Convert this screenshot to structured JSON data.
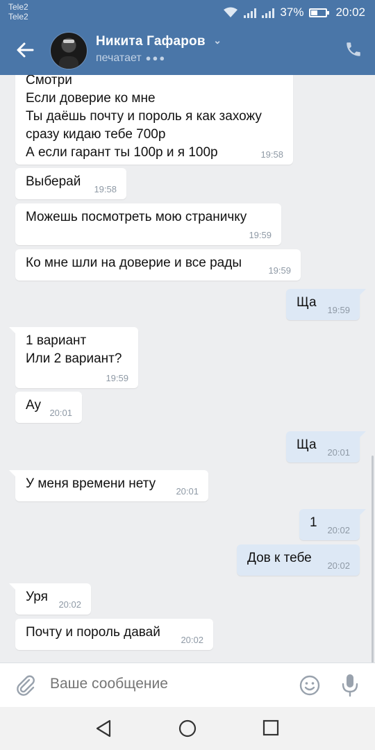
{
  "status_bar": {
    "carrier1": "Tele2",
    "carrier2": "Tele2",
    "battery": "37%",
    "time": "20:02",
    "icons": [
      "wifi-icon",
      "signal-icon",
      "signal-icon",
      "battery-icon"
    ]
  },
  "header": {
    "name": "Никита Гафаров",
    "status": "печатает",
    "icons": [
      "back-arrow-icon",
      "chevron-down-icon",
      "phone-icon"
    ]
  },
  "messages": [
    {
      "dir": "in",
      "text": "Смотри\nЕсли доверие ко мне\nТы даёшь почту и пороль я как захожу\nсразу кидаю тебе 700р\nА если гарант ты 100р и я 100р",
      "time": "19:58"
    },
    {
      "dir": "in",
      "text": "Выберай",
      "time": "19:58"
    },
    {
      "dir": "in",
      "text": "Можешь посмотреть мою страничку",
      "time": "19:59"
    },
    {
      "dir": "in",
      "text": "Ко мне шли на доверие и все рады",
      "time": "19:59"
    },
    {
      "dir": "out",
      "text": "Ща",
      "time": "19:59"
    },
    {
      "dir": "in",
      "text": "1 вариант\nИли 2 вариант?",
      "time": "19:59"
    },
    {
      "dir": "in",
      "text": "Ау",
      "time": "20:01"
    },
    {
      "dir": "out",
      "text": "Ща",
      "time": "20:01"
    },
    {
      "dir": "in",
      "text": "У меня времени нету",
      "time": "20:01"
    },
    {
      "dir": "out",
      "text": "1",
      "time": "20:02"
    },
    {
      "dir": "out",
      "text": "Дов к тебе",
      "time": "20:02"
    },
    {
      "dir": "in",
      "text": "Уря",
      "time": "20:02"
    },
    {
      "dir": "in",
      "text": "Почту и пороль давай",
      "time": "20:02"
    }
  ],
  "composer": {
    "placeholder": "Ваше сообщение",
    "icons": [
      "paperclip-icon",
      "emoji-icon",
      "microphone-icon"
    ]
  },
  "nav": {
    "icons": [
      "nav-back-icon",
      "nav-home-icon",
      "nav-recents-icon"
    ]
  },
  "colors": {
    "header": "#4a76a8",
    "incoming_bubble": "#ffffff",
    "outgoing_bubble": "#dde8f5",
    "chat_background": "#edeef0"
  }
}
